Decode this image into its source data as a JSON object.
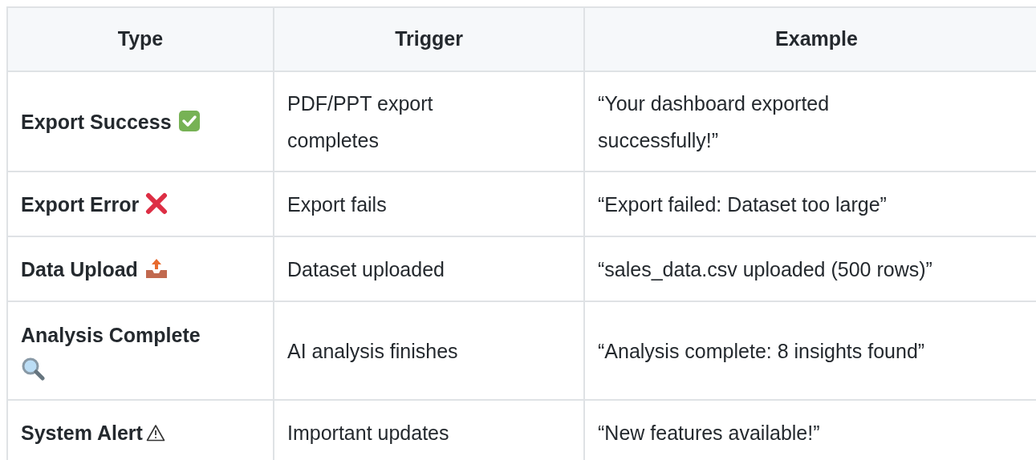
{
  "table": {
    "columns": [
      "Type",
      "Trigger",
      "Example"
    ],
    "rows": [
      {
        "kind": "success",
        "type": "Export Success",
        "trigger": "PDF/PPT export completes",
        "example": "“Your dashboard exported successfully!”"
      },
      {
        "kind": "error",
        "type": "Export Error",
        "trigger": "Export fails",
        "example": "“Export failed: Dataset too large”"
      },
      {
        "kind": "upload",
        "type": "Data Upload",
        "trigger": "Dataset uploaded",
        "example": "“sales_data.csv uploaded (500 rows)”"
      },
      {
        "kind": "analysis",
        "type": "Analysis Complete",
        "trigger": "AI analysis finishes",
        "example": "“Analysis complete: 8 insights found”"
      },
      {
        "kind": "alert",
        "type": "System Alert",
        "trigger": "Important updates",
        "example": "“New features available!”"
      }
    ]
  }
}
